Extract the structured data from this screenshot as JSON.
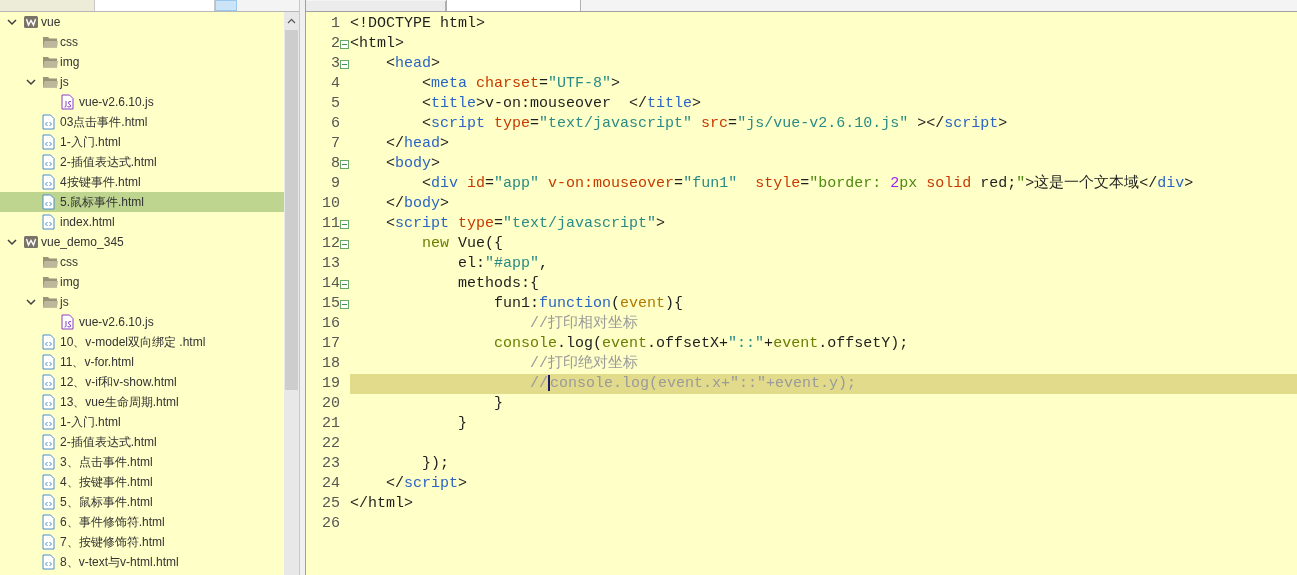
{
  "project_tree": [
    {
      "label": "vue",
      "kind": "project",
      "expanded": true,
      "selected": false,
      "children": [
        {
          "label": "css",
          "kind": "folder",
          "selected": false
        },
        {
          "label": "img",
          "kind": "folder",
          "selected": false
        },
        {
          "label": "js",
          "kind": "folder",
          "expanded": true,
          "selected": false,
          "children": [
            {
              "label": "vue-v2.6.10.js",
              "kind": "js",
              "selected": false
            }
          ]
        },
        {
          "label": "03点击事件.html",
          "kind": "html",
          "selected": false
        },
        {
          "label": "1-入门.html",
          "kind": "html",
          "selected": false
        },
        {
          "label": "2-插值表达式.html",
          "kind": "html",
          "selected": false
        },
        {
          "label": "4按键事件.html",
          "kind": "html",
          "selected": false
        },
        {
          "label": "5.鼠标事件.html",
          "kind": "html",
          "selected": true
        },
        {
          "label": "index.html",
          "kind": "html",
          "selected": false
        }
      ]
    },
    {
      "label": "vue_demo_345",
      "kind": "project",
      "expanded": true,
      "selected": false,
      "children": [
        {
          "label": "css",
          "kind": "folder",
          "selected": false
        },
        {
          "label": "img",
          "kind": "folder",
          "selected": false
        },
        {
          "label": "js",
          "kind": "folder",
          "expanded": true,
          "selected": false,
          "children": [
            {
              "label": "vue-v2.6.10.js",
              "kind": "js",
              "selected": false
            }
          ]
        },
        {
          "label": "10、v-model双向绑定 .html",
          "kind": "html",
          "selected": false
        },
        {
          "label": "11、v-for.html",
          "kind": "html",
          "selected": false
        },
        {
          "label": "12、v-if和v-show.html",
          "kind": "html",
          "selected": false
        },
        {
          "label": "13、vue生命周期.html",
          "kind": "html",
          "selected": false
        },
        {
          "label": "1-入门.html",
          "kind": "html",
          "selected": false
        },
        {
          "label": "2-插值表达式.html",
          "kind": "html",
          "selected": false
        },
        {
          "label": "3、点击事件.html",
          "kind": "html",
          "selected": false
        },
        {
          "label": "4、按键事件.html",
          "kind": "html",
          "selected": false
        },
        {
          "label": "5、鼠标事件.html",
          "kind": "html",
          "selected": false
        },
        {
          "label": "6、事件修饰符.html",
          "kind": "html",
          "selected": false
        },
        {
          "label": "7、按键修饰符.html",
          "kind": "html",
          "selected": false
        },
        {
          "label": "8、v-text与v-html.html",
          "kind": "html",
          "selected": false
        }
      ]
    }
  ],
  "editor": {
    "lines": [
      {
        "number": "1",
        "foldable": false,
        "current": false,
        "tokens": [
          {
            "t": "<!DOCTYPE html>",
            "kind": "plain"
          }
        ]
      },
      {
        "number": "2",
        "foldable": true,
        "current": false,
        "tokens": [
          {
            "t": "<html>",
            "kind": "plain"
          }
        ]
      },
      {
        "number": "3",
        "foldable": true,
        "current": false,
        "tokens": [
          {
            "t": "    <",
            "kind": "plain"
          },
          {
            "t": "head",
            "kind": "tag"
          },
          {
            "t": ">",
            "kind": "plain"
          }
        ]
      },
      {
        "number": "4",
        "foldable": false,
        "current": false,
        "tokens": [
          {
            "t": "        <",
            "kind": "plain"
          },
          {
            "t": "meta",
            "kind": "tag"
          },
          {
            "t": " charset",
            "kind": "attr"
          },
          {
            "t": "=",
            "kind": "plain"
          },
          {
            "t": "\"UTF-8\"",
            "kind": "str"
          },
          {
            "t": ">",
            "kind": "plain"
          }
        ]
      },
      {
        "number": "5",
        "foldable": false,
        "current": false,
        "tokens": [
          {
            "t": "        <",
            "kind": "plain"
          },
          {
            "t": "title",
            "kind": "tag"
          },
          {
            "t": ">v-on:mouseover  </",
            "kind": "plain"
          },
          {
            "t": "title",
            "kind": "tag"
          },
          {
            "t": ">",
            "kind": "plain"
          }
        ]
      },
      {
        "number": "6",
        "foldable": false,
        "current": false,
        "tokens": [
          {
            "t": "        <",
            "kind": "plain"
          },
          {
            "t": "script",
            "kind": "tag"
          },
          {
            "t": " type",
            "kind": "attr"
          },
          {
            "t": "=",
            "kind": "plain"
          },
          {
            "t": "\"text/javascript\"",
            "kind": "str"
          },
          {
            "t": " src",
            "kind": "attr"
          },
          {
            "t": "=",
            "kind": "plain"
          },
          {
            "t": "\"js/vue-v2.6.10.js\"",
            "kind": "str"
          },
          {
            "t": " ></",
            "kind": "plain"
          },
          {
            "t": "script",
            "kind": "tag"
          },
          {
            "t": ">",
            "kind": "plain"
          }
        ]
      },
      {
        "number": "7",
        "foldable": false,
        "current": false,
        "tokens": [
          {
            "t": "    </",
            "kind": "plain"
          },
          {
            "t": "head",
            "kind": "tag"
          },
          {
            "t": ">",
            "kind": "plain"
          }
        ]
      },
      {
        "number": "8",
        "foldable": true,
        "current": false,
        "tokens": [
          {
            "t": "    <",
            "kind": "plain"
          },
          {
            "t": "body",
            "kind": "tag"
          },
          {
            "t": ">",
            "kind": "plain"
          }
        ]
      },
      {
        "number": "9",
        "foldable": false,
        "current": false,
        "tokens": [
          {
            "t": "        <",
            "kind": "plain"
          },
          {
            "t": "div",
            "kind": "tag"
          },
          {
            "t": " id",
            "kind": "attr"
          },
          {
            "t": "=",
            "kind": "plain"
          },
          {
            "t": "\"app\"",
            "kind": "str"
          },
          {
            "t": " v-on:mouseover",
            "kind": "attr"
          },
          {
            "t": "=",
            "kind": "plain"
          },
          {
            "t": "\"fun1\"",
            "kind": "str"
          },
          {
            "t": "  style",
            "kind": "attr"
          },
          {
            "t": "=",
            "kind": "plain"
          },
          {
            "t": "\"border: ",
            "kind": "css"
          },
          {
            "t": "2",
            "kind": "num"
          },
          {
            "t": "px ",
            "kind": "css"
          },
          {
            "t": "solid",
            "kind": "attr"
          },
          {
            "t": " red;",
            "kind": "plain"
          },
          {
            "t": "\"",
            "kind": "css"
          },
          {
            "t": ">这是一个文本域</",
            "kind": "plain"
          },
          {
            "t": "div",
            "kind": "tag"
          },
          {
            "t": ">",
            "kind": "plain"
          }
        ]
      },
      {
        "number": "10",
        "foldable": false,
        "current": false,
        "tokens": [
          {
            "t": "    </",
            "kind": "plain"
          },
          {
            "t": "body",
            "kind": "tag"
          },
          {
            "t": ">",
            "kind": "plain"
          }
        ]
      },
      {
        "number": "11",
        "foldable": true,
        "current": false,
        "tokens": [
          {
            "t": "    <",
            "kind": "plain"
          },
          {
            "t": "script",
            "kind": "tag"
          },
          {
            "t": " type",
            "kind": "attr"
          },
          {
            "t": "=",
            "kind": "plain"
          },
          {
            "t": "\"text/javascript\"",
            "kind": "str"
          },
          {
            "t": ">",
            "kind": "plain"
          }
        ]
      },
      {
        "number": "12",
        "foldable": true,
        "current": false,
        "tokens": [
          {
            "t": "        new",
            "kind": "kw"
          },
          {
            "t": " Vue({",
            "kind": "plain"
          }
        ]
      },
      {
        "number": "13",
        "foldable": false,
        "current": false,
        "tokens": [
          {
            "t": "            el:",
            "kind": "plain"
          },
          {
            "t": "\"#app\"",
            "kind": "str"
          },
          {
            "t": ",",
            "kind": "plain"
          }
        ]
      },
      {
        "number": "14",
        "foldable": true,
        "current": false,
        "tokens": [
          {
            "t": "            methods:{",
            "kind": "plain"
          }
        ]
      },
      {
        "number": "15",
        "foldable": true,
        "current": false,
        "tokens": [
          {
            "t": "                fun1:",
            "kind": "plain"
          },
          {
            "t": "function",
            "kind": "tag"
          },
          {
            "t": "(",
            "kind": "plain"
          },
          {
            "t": "event",
            "kind": "param"
          },
          {
            "t": "){",
            "kind": "plain"
          }
        ]
      },
      {
        "number": "16",
        "foldable": false,
        "current": false,
        "tokens": [
          {
            "t": "                    //打印相对坐标",
            "kind": "comment"
          }
        ]
      },
      {
        "number": "17",
        "foldable": false,
        "current": false,
        "tokens": [
          {
            "t": "                console",
            "kind": "kw"
          },
          {
            "t": ".log(",
            "kind": "plain"
          },
          {
            "t": "event",
            "kind": "kw"
          },
          {
            "t": ".offsetX+",
            "kind": "plain"
          },
          {
            "t": "\"::\"",
            "kind": "str"
          },
          {
            "t": "+",
            "kind": "plain"
          },
          {
            "t": "event",
            "kind": "kw"
          },
          {
            "t": ".offsetY);",
            "kind": "plain"
          }
        ]
      },
      {
        "number": "18",
        "foldable": false,
        "current": false,
        "tokens": [
          {
            "t": "                    //打印绝对坐标",
            "kind": "comment"
          }
        ]
      },
      {
        "number": "19",
        "foldable": false,
        "current": true,
        "caret": true,
        "tokens": [
          {
            "t": "                    //",
            "kind": "comment"
          },
          {
            "t": "console.log(event.x+\"::\"+event.y);",
            "kind": "comment"
          }
        ]
      },
      {
        "number": "20",
        "foldable": false,
        "current": false,
        "tokens": [
          {
            "t": "                }",
            "kind": "plain"
          }
        ]
      },
      {
        "number": "21",
        "foldable": false,
        "current": false,
        "tokens": [
          {
            "t": "            }",
            "kind": "plain"
          }
        ]
      },
      {
        "number": "22",
        "foldable": false,
        "current": false
      },
      {
        "number": "23",
        "foldable": false,
        "current": false,
        "tokens": [
          {
            "t": "        });",
            "kind": "plain"
          }
        ]
      },
      {
        "number": "24",
        "foldable": false,
        "current": false,
        "tokens": [
          {
            "t": "    </",
            "kind": "plain"
          },
          {
            "t": "script",
            "kind": "tag"
          },
          {
            "t": ">",
            "kind": "plain"
          }
        ]
      },
      {
        "number": "25",
        "foldable": false,
        "current": false,
        "tokens": [
          {
            "t": "</html>",
            "kind": "plain"
          }
        ]
      },
      {
        "number": "26",
        "foldable": false,
        "current": false
      }
    ]
  }
}
